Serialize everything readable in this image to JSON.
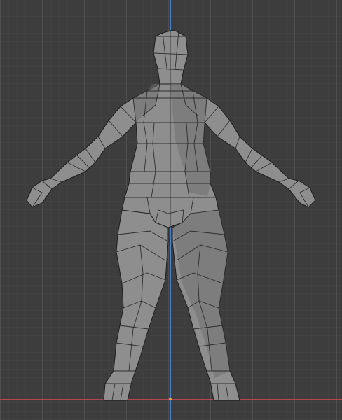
{
  "viewport": {
    "mode": "orthographic-back-view",
    "object": "low-poly-human-mesh",
    "show_grid": true,
    "colors": {
      "background": "#3d3d3d",
      "grid_line": "#555555",
      "z_axis": "#4f84c4",
      "x_axis": "#b3494f",
      "origin": "#e8a038",
      "mesh_fill": "#8e8e8e",
      "mesh_shadow": "#6f6f6f",
      "mesh_edge": "#1e1e1e"
    }
  }
}
